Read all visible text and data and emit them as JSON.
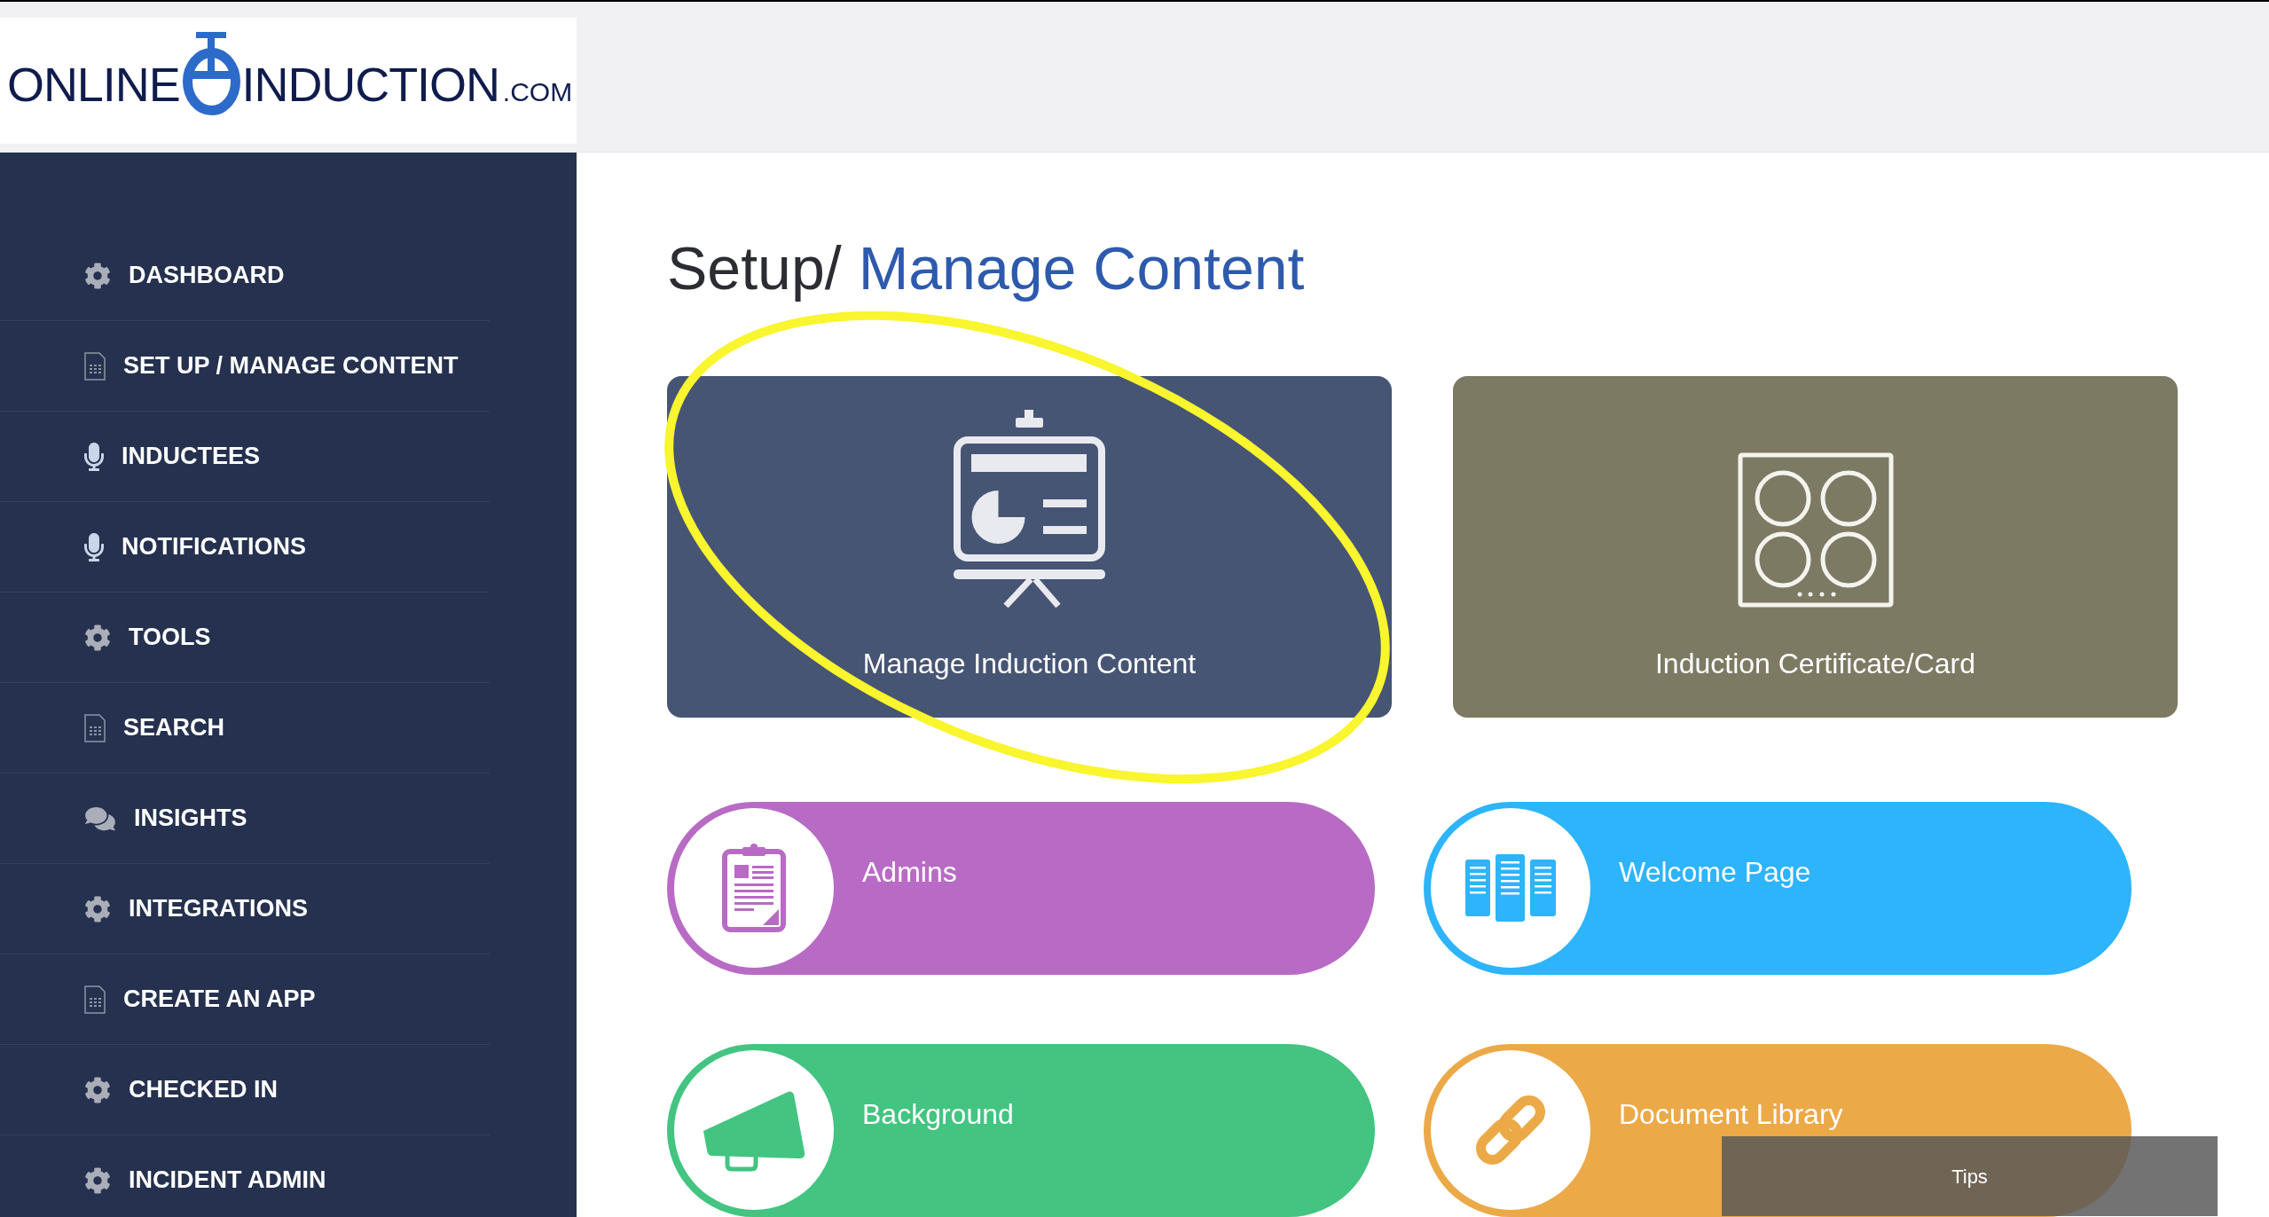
{
  "logo": {
    "left": "ONLINE",
    "right": "INDUCTION",
    "suffix": ".COM"
  },
  "sidebar": {
    "items": [
      {
        "label": "DASHBOARD",
        "kind": "gear"
      },
      {
        "label": "SET UP / MANAGE CONTENT",
        "kind": "document"
      },
      {
        "label": "INDUCTEES",
        "kind": "microphone"
      },
      {
        "label": "NOTIFICATIONS",
        "kind": "microphone"
      },
      {
        "label": "TOOLS",
        "kind": "gear"
      },
      {
        "label": "SEARCH",
        "kind": "document"
      },
      {
        "label": "INSIGHTS",
        "kind": "chat"
      },
      {
        "label": "INTEGRATIONS",
        "kind": "gear"
      },
      {
        "label": "CREATE AN APP",
        "kind": "document"
      },
      {
        "label": "CHECKED IN",
        "kind": "gear"
      },
      {
        "label": "INCIDENT ADMIN",
        "kind": "gear"
      }
    ]
  },
  "page_title": {
    "prefix": "Setup/",
    "highlight": "Manage Content"
  },
  "cards": [
    {
      "label": "Manage Induction Content",
      "kind": "presentation",
      "color": "#475574",
      "highlighted": true
    },
    {
      "label": "Induction Certificate/Card",
      "kind": "cooktop",
      "color": "#7c7a63",
      "highlighted": false
    }
  ],
  "tiles": [
    {
      "label": "Admins",
      "kind": "clipboard",
      "color": "#b86bc4"
    },
    {
      "label": "Welcome Page",
      "kind": "panels",
      "color": "#2db4fb"
    },
    {
      "label": "Background",
      "kind": "megaphone",
      "color": "#43c481"
    },
    {
      "label": "Document Library",
      "kind": "link",
      "color": "#eca948"
    }
  ],
  "tips": {
    "label": "Tips"
  }
}
